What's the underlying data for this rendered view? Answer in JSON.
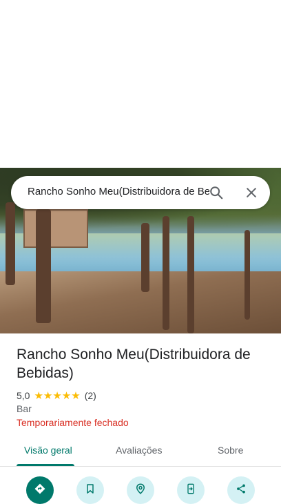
{
  "search": {
    "query": "Rancho Sonho Meu(Distribuidora de Bebidas)"
  },
  "place": {
    "name": "Rancho Sonho Meu(Distribuidora de Bebidas)",
    "rating": "5,0",
    "stars": "★★★★★",
    "review_count": "(2)",
    "category": "Bar",
    "status": "Temporariamente fechado"
  },
  "tabs": [
    {
      "label": "Visão geral",
      "active": true
    },
    {
      "label": "Avaliações",
      "active": false
    },
    {
      "label": "Sobre",
      "active": false
    }
  ],
  "actions": [
    {
      "icon": "directions-icon"
    },
    {
      "icon": "bookmark-icon"
    },
    {
      "icon": "nearby-icon"
    },
    {
      "icon": "send-to-phone-icon"
    },
    {
      "icon": "share-icon"
    }
  ],
  "colors": {
    "accent": "#00796b",
    "action_bg": "#d4f1f4",
    "status_red": "#d93025",
    "star": "#fbbc04"
  }
}
